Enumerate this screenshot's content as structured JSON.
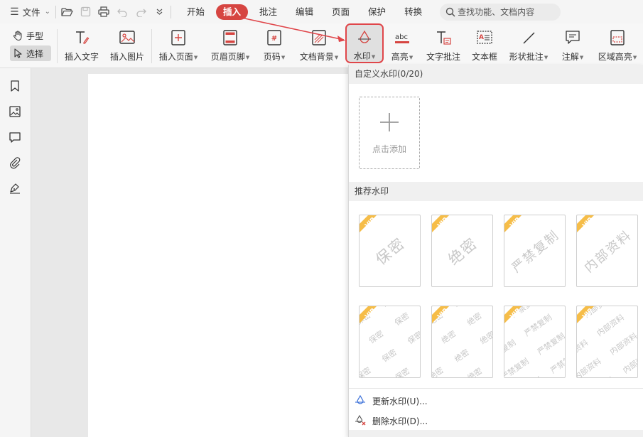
{
  "menubar": {
    "file_label": "文件",
    "tabs": [
      {
        "label": "开始",
        "active": false
      },
      {
        "label": "插入",
        "active": true
      },
      {
        "label": "批注",
        "active": false
      },
      {
        "label": "编辑",
        "active": false
      },
      {
        "label": "页面",
        "active": false
      },
      {
        "label": "保护",
        "active": false
      },
      {
        "label": "转换",
        "active": false
      }
    ],
    "search_placeholder": "查找功能、文档内容"
  },
  "ribbon": {
    "hand_label": "手型",
    "select_label": "选择",
    "buttons": [
      {
        "label": "插入文字",
        "icon": "insert-text-icon",
        "dropdown": false
      },
      {
        "label": "插入图片",
        "icon": "insert-image-icon",
        "dropdown": false
      },
      {
        "label": "插入页面",
        "icon": "insert-page-icon",
        "dropdown": true
      },
      {
        "label": "页眉页脚",
        "icon": "header-footer-icon",
        "dropdown": true
      },
      {
        "label": "页码",
        "icon": "page-number-icon",
        "dropdown": true
      },
      {
        "label": "文档背景",
        "icon": "document-background-icon",
        "dropdown": true
      },
      {
        "label": "水印",
        "icon": "watermark-icon",
        "dropdown": true
      },
      {
        "label": "高亮",
        "icon": "highlight-icon",
        "dropdown": true
      },
      {
        "label": "文字批注",
        "icon": "text-annotation-icon",
        "dropdown": false
      },
      {
        "label": "文本框",
        "icon": "text-box-icon",
        "dropdown": false
      },
      {
        "label": "形状批注",
        "icon": "shape-annotation-icon",
        "dropdown": true
      },
      {
        "label": "注解",
        "icon": "note-icon",
        "dropdown": true
      },
      {
        "label": "区域高亮",
        "icon": "area-highlight-icon",
        "dropdown": true
      }
    ]
  },
  "panel": {
    "custom_header": "自定义水印(0/20)",
    "add_label": "点击添加",
    "recommended_header": "推荐水印",
    "vip_badge": "VIP",
    "watermarks_single": [
      "保密",
      "绝密",
      "严禁复制",
      "内部资料"
    ],
    "watermarks_tiled": [
      "保密",
      "绝密",
      "严禁复制",
      "内部资料"
    ],
    "update_label": "更新水印(U)...",
    "delete_label": "删除水印(D)..."
  },
  "colors": {
    "accent": "#d64541",
    "highlight_border": "#e0464a",
    "vip_gold": "#f6bd48"
  }
}
